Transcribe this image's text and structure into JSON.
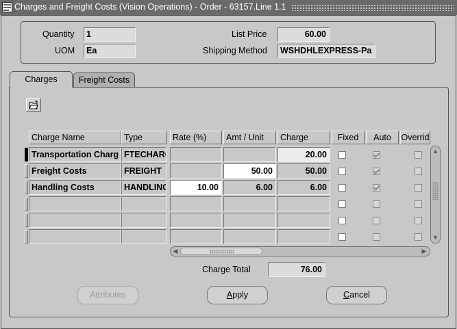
{
  "window": {
    "title": "Charges and Freight Costs (Vision Operations) - Order - 63157.Line 1.1"
  },
  "header": {
    "quantity_label": "Quantity",
    "quantity_value": "1",
    "uom_label": "UOM",
    "uom_value": "Ea",
    "list_price_label": "List Price",
    "list_price_value": "60.00",
    "shipping_method_label": "Shipping Method",
    "shipping_method_value": "WSHDHLEXPRESS-Pa"
  },
  "tabs": [
    {
      "label": "Charges",
      "active": true
    },
    {
      "label": "Freight Costs",
      "active": false
    }
  ],
  "toolbar": {
    "icon": "folder-open-icon"
  },
  "table": {
    "columns": [
      "Charge Name",
      "Type",
      "Rate (%)",
      "Amt / Unit",
      "Charge",
      "Fixed",
      "Auto",
      "Overrid"
    ],
    "rows": [
      {
        "name": "Transportation Charg",
        "type": "FTECHARG",
        "rate": "",
        "amt": "",
        "charge": "20.00",
        "fixed": false,
        "auto": true,
        "override": false
      },
      {
        "name": "Freight Costs",
        "type": "FREIGHT",
        "rate": "",
        "amt": "50.00",
        "charge": "50.00",
        "fixed": false,
        "auto": true,
        "override": false
      },
      {
        "name": "Handling Costs",
        "type": "HANDLING",
        "rate": "10.00",
        "amt": "6.00",
        "charge": "6.00",
        "fixed": false,
        "auto": true,
        "override": false
      },
      {
        "name": "",
        "type": "",
        "rate": "",
        "amt": "",
        "charge": "",
        "fixed": false,
        "auto": false,
        "override": false
      },
      {
        "name": "",
        "type": "",
        "rate": "",
        "amt": "",
        "charge": "",
        "fixed": false,
        "auto": false,
        "override": false
      },
      {
        "name": "",
        "type": "",
        "rate": "",
        "amt": "",
        "charge": "",
        "fixed": false,
        "auto": false,
        "override": false
      }
    ]
  },
  "totals": {
    "charge_total_label": "Charge Total",
    "charge_total_value": "76.00"
  },
  "buttons": {
    "attributes": "Attributes",
    "apply_prefix": "",
    "apply_mnemonic": "A",
    "apply_rest": "pply",
    "cancel_prefix": "",
    "cancel_mnemonic": "C",
    "cancel_rest": "ancel"
  },
  "colors": {
    "background": "#c8c8c8",
    "title_bar": "#6a6a6a",
    "editable_field": "#ffffff"
  }
}
